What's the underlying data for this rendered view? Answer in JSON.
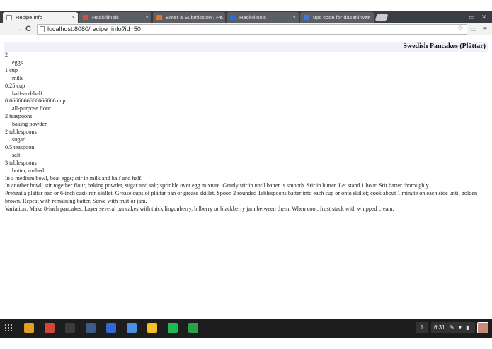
{
  "browser": {
    "tabs": [
      {
        "label": "Recipe Info",
        "active": true,
        "favicon_color": "#ffffff"
      },
      {
        "label": "HackIllinois",
        "active": false,
        "favicon_color": "#e04a3a"
      },
      {
        "label": "Enter a Submission | Ha",
        "active": false,
        "favicon_color": "#e0762a"
      },
      {
        "label": "HackIllinois",
        "active": false,
        "favicon_color": "#2a6ed8"
      },
      {
        "label": "upc code for dasani wat",
        "active": false,
        "favicon_color": "#3b78e7"
      }
    ],
    "close_glyph": "×",
    "minimize_glyph": "▭",
    "close_window_glyph": "✕",
    "url": "localhost:8080/recipe_info?id=50",
    "back_icon": "←",
    "forward_icon": "→",
    "reload_icon": "C",
    "star_icon": "☆",
    "cast_icon": "▭",
    "menu_icon": "≡"
  },
  "recipe": {
    "title": "Swedish Pancakes (Plättar)",
    "ingredients": [
      {
        "quantity": "2",
        "name": "eggs"
      },
      {
        "quantity": "1 cup",
        "name": "milk"
      },
      {
        "quantity": "0.25 cup",
        "name": "half-and-half"
      },
      {
        "quantity": "0.6666666666666666 cup",
        "name": "all-purpose flour"
      },
      {
        "quantity": "2 teaspoons",
        "name": "baking powder"
      },
      {
        "quantity": "2 tablespoons",
        "name": "sugar"
      },
      {
        "quantity": "0.5 teaspoon",
        "name": "salt"
      },
      {
        "quantity": "3 tablespoons",
        "name": "butter, melted"
      }
    ],
    "instructions": [
      "In a medium bowl, beat eggs; stir in milk and half and half.",
      "In another bowl, stir together flour, baking powder, sugar and salt; sprinkle over egg mixture. Gently stir in until batter is smooth. Stir in butter. Let stand 1 hour. Stir batter thoroughly.",
      "Preheat a plättar pan or 6-inch cast-iron skillet. Grease cups of plättar pan or grease skillet. Spoon 2 rounded Tablespoons batter into each cup or onto skillet; cook about 1 minute on each side until golden brown. Repeat with remaining batter. Serve with fruit or jam.",
      "Variation: Make 8-inch pancakes. Layer several pancakes with thick lingonberry, bilberry or blackberry jam between them. When cool, frost stack with whipped cream."
    ]
  },
  "taskbar": {
    "apps": [
      {
        "name": "chrome-icon",
        "color": "#e0a020"
      },
      {
        "name": "gmail-icon",
        "color": "#d44638"
      },
      {
        "name": "terminal-icon",
        "color": "#3a3a3a"
      },
      {
        "name": "editor-icon",
        "color": "#3c5a8a"
      },
      {
        "name": "calendar-icon",
        "color": "#3367d6"
      },
      {
        "name": "files-icon",
        "color": "#4a8fe0"
      },
      {
        "name": "keep-icon",
        "color": "#f6c026"
      },
      {
        "name": "spotify-icon",
        "color": "#1db954"
      },
      {
        "name": "drive-icon",
        "color": "#2aa34a"
      }
    ],
    "workspace_number": "1",
    "time": "6:31",
    "tray_icons": "✎ ▾ ▮"
  }
}
